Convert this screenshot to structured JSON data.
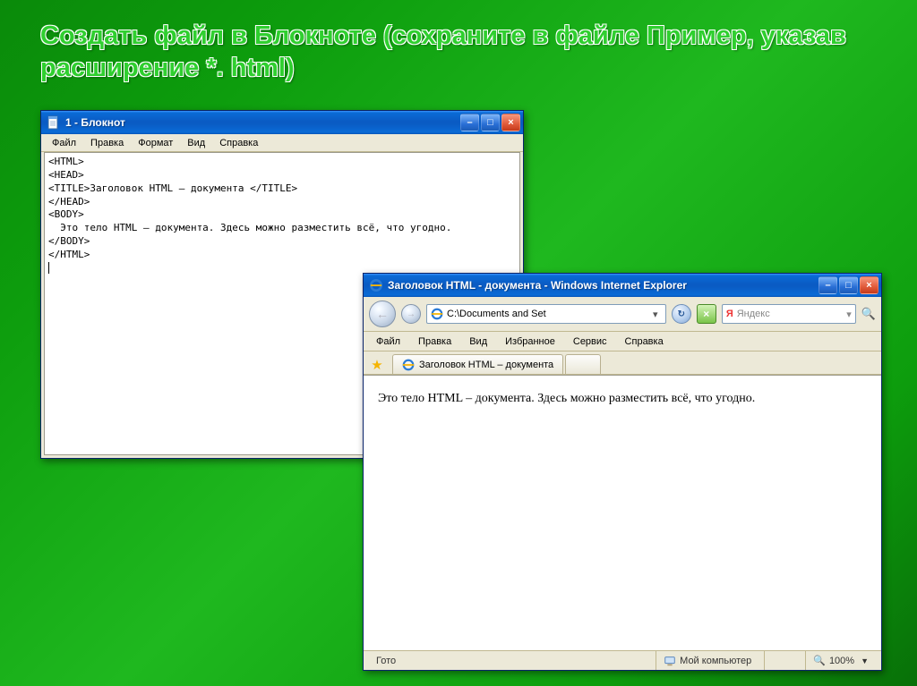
{
  "slide": {
    "heading": "Создать файл в Блокноте (сохраните в файле Пример,  указав расширение   *. html)"
  },
  "notepad": {
    "title": "1 - Блокнот",
    "menu": {
      "file": "Файл",
      "edit": "Правка",
      "format": "Формат",
      "view": "Вид",
      "help": "Справка"
    },
    "content": "<HTML>\n<HEAD>\n<TITLE>Заголовок HTML – документа </TITLE>\n</HEAD>\n<BODY>\n  Это тело HTML – документа. Здесь можно разместить всё, что угодно.\n</BODY>\n</HTML>"
  },
  "ie": {
    "title": "Заголовок HTML - документа - Windows Internet Explorer",
    "address": "C:\\Documents and Set",
    "search_placeholder": "Яндекс",
    "menu": {
      "file": "Файл",
      "edit": "Правка",
      "view": "Вид",
      "favorites": "Избранное",
      "tools": "Сервис",
      "help": "Справка"
    },
    "tab_label": "Заголовок HTML – документа",
    "page_body": "Это тело HTML – документа. Здесь можно разместить всё, что угодно.",
    "status_ready": "Гото",
    "status_zone": "Мой компьютер",
    "status_zoom": "100%"
  }
}
